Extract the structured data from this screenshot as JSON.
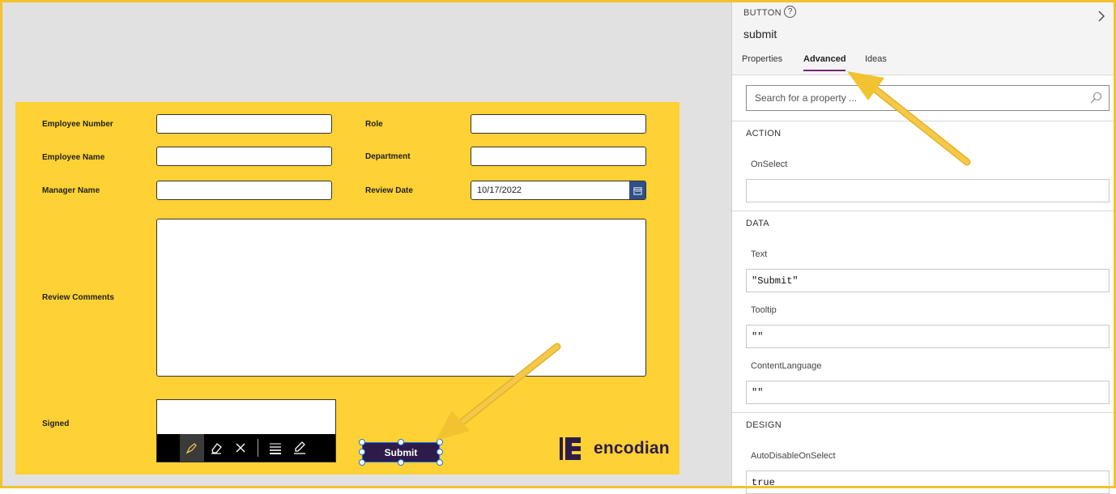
{
  "form": {
    "employee_number_label": "Employee Number",
    "employee_name_label": "Employee Name",
    "manager_name_label": "Manager Name",
    "role_label": "Role",
    "department_label": "Department",
    "review_date_label": "Review Date",
    "review_date_value": "10/17/2022",
    "review_comments_label": "Review Comments",
    "signed_label": "Signed",
    "submit_label": "Submit",
    "logo_text": "encodian"
  },
  "panel": {
    "control_type": "BUTTON",
    "help": "?",
    "control_name": "submit",
    "tabs": [
      "Properties",
      "Advanced",
      "Ideas"
    ],
    "active_tab": "Advanced",
    "search_placeholder": "Search for a property ...",
    "sections": {
      "action": {
        "title": "ACTION",
        "onselect_label": "OnSelect",
        "onselect_value": ""
      },
      "data": {
        "title": "DATA",
        "text_label": "Text",
        "text_value": "\"Submit\"",
        "tooltip_label": "Tooltip",
        "tooltip_value": "\"\"",
        "contentlanguage_label": "ContentLanguage",
        "contentlanguage_value": "\"\""
      },
      "design": {
        "title": "DESIGN",
        "autodisable_label": "AutoDisableOnSelect",
        "autodisable_value": "true"
      }
    }
  },
  "colors": {
    "form_background": "#fed134",
    "button_background": "#2d1c49",
    "tab_accent": "#742774",
    "annotation_arrow": "#f2c230"
  },
  "icons": [
    "help-icon",
    "collapse-chevron-icon",
    "search-icon",
    "calendar-icon",
    "pen-icon",
    "eraser-icon",
    "clear-icon",
    "thickness-icon",
    "edit-icon"
  ]
}
